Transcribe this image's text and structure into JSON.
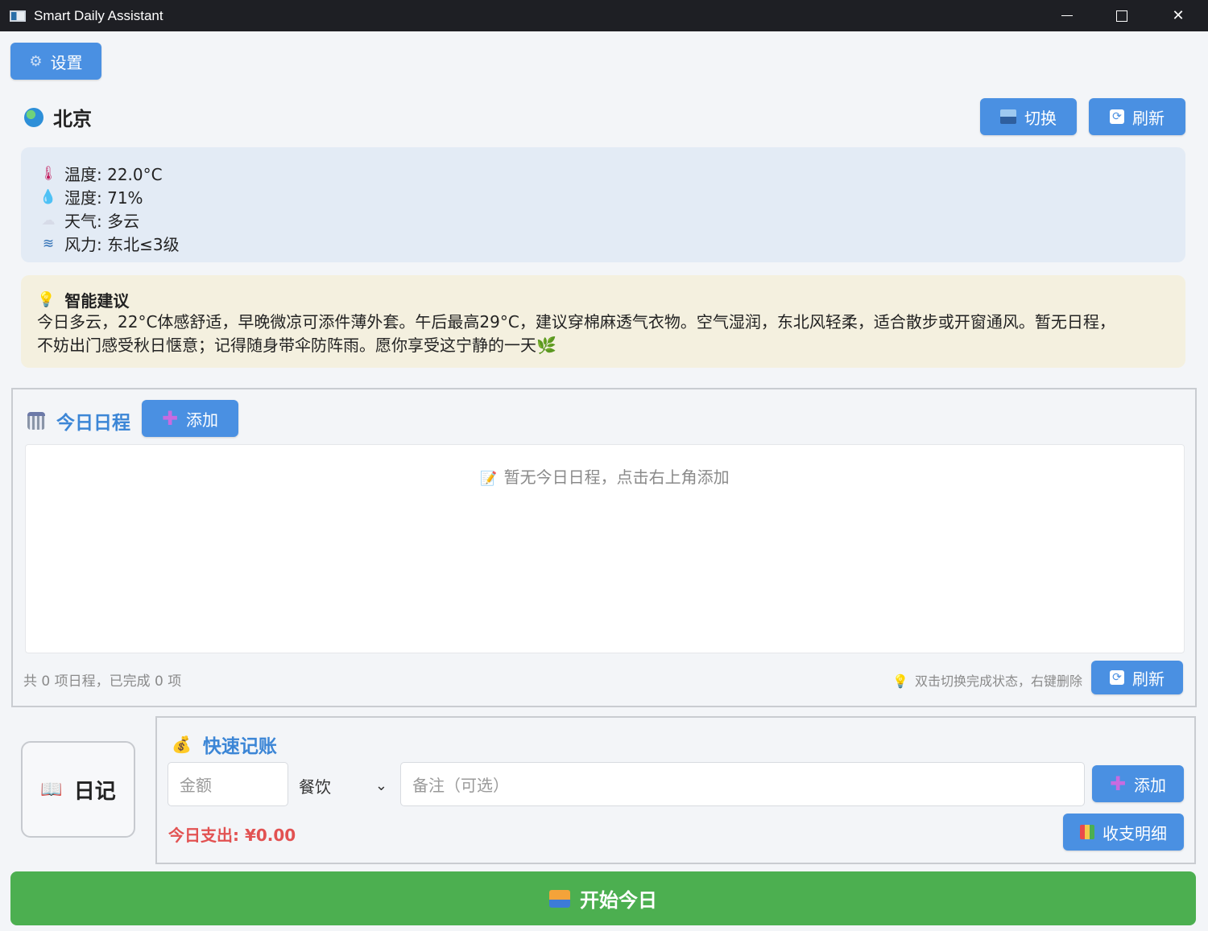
{
  "window": {
    "title": "Smart Daily Assistant"
  },
  "toolbar": {
    "settings_label": "设置"
  },
  "location": {
    "city": "北京",
    "switch_label": "切换",
    "refresh_label": "刷新"
  },
  "weather": {
    "temperature": "温度: 22.0°C",
    "humidity": "湿度: 71%",
    "condition": "天气: 多云",
    "wind": "风力: 东北≤3级"
  },
  "advice": {
    "title": "智能建议",
    "line1": "今日多云，22°C体感舒适，早晚微凉可添件薄外套。午后最高29°C，建议穿棉麻透气衣物。空气湿润，东北风轻柔，适合散步或开窗通风。暂无日程，",
    "line2": "不妨出门感受秋日惬意；记得随身带伞防阵雨。愿你享受这宁静的一天🌿"
  },
  "schedule": {
    "title": "今日日程",
    "add_label": "添加",
    "empty_message": "暂无今日日程，点击右上角添加",
    "stats": "共 0 项日程，已完成 0 项",
    "hint": "双击切换完成状态，右键删除",
    "refresh_label": "刷新"
  },
  "diary": {
    "label": "日记"
  },
  "accounting": {
    "title": "快速记账",
    "amount_placeholder": "金额",
    "category_selected": "餐饮",
    "note_placeholder": "备注（可选）",
    "add_label": "添加",
    "today_spend": "今日支出: ¥0.00",
    "details_label": "收支明细"
  },
  "start": {
    "label": "开始今日"
  },
  "colors": {
    "accent": "#4a90e2",
    "start_green": "#4caf50",
    "spend_red": "#e25252",
    "section_title": "#3c86d6"
  },
  "icons": {
    "settings": "gear-icon",
    "globe": "globe-icon",
    "switch": "city-switch-icon",
    "refresh": "refresh-icon",
    "thermometer": "thermometer-icon",
    "droplet": "droplet-icon",
    "cloud": "cloud-icon",
    "wind": "wind-icon",
    "bulb": "bulb-icon",
    "calendar": "calendar-icon",
    "plus": "plus-icon",
    "memo": "memo-icon",
    "book": "book-icon",
    "moneybag": "moneybag-icon",
    "chart": "chart-icon",
    "sunrise": "sunrise-icon"
  }
}
